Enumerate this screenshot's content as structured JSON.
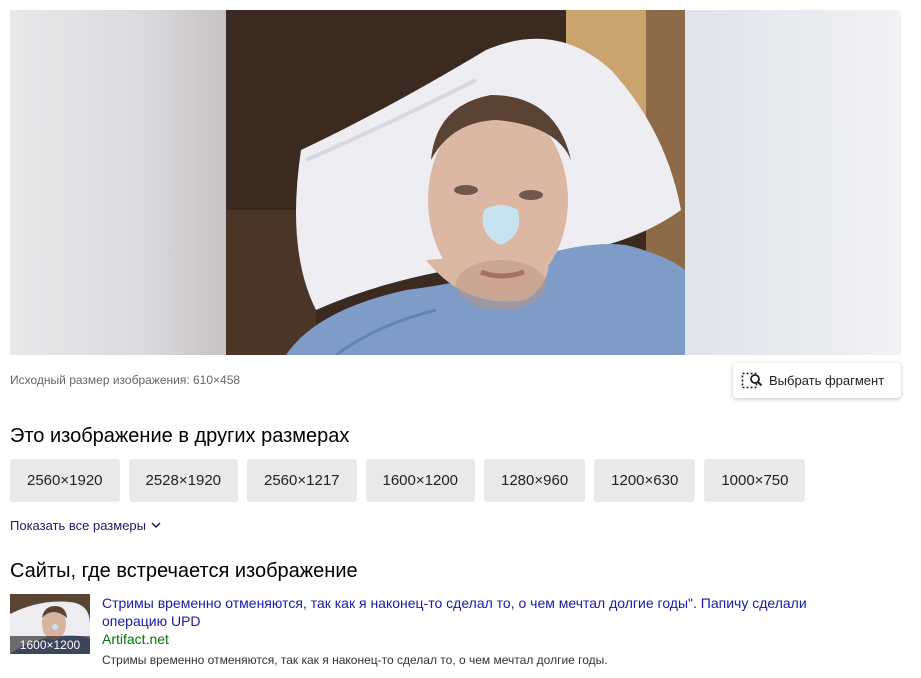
{
  "preview": {
    "image": "hospital-selfie-photo"
  },
  "original_size": {
    "caption": "Исходный размер изображения: 610×458"
  },
  "fragment_button": {
    "label": "Выбрать фрагмент",
    "icon": "select-fragment-icon"
  },
  "other_sizes": {
    "heading": "Это изображение в других размерах",
    "items": [
      {
        "label": "2560×1920"
      },
      {
        "label": "2528×1920"
      },
      {
        "label": "2560×1217"
      },
      {
        "label": "1600×1200"
      },
      {
        "label": "1280×960"
      },
      {
        "label": "1200×630"
      },
      {
        "label": "1000×750"
      }
    ],
    "show_all_label": "Показать все размеры"
  },
  "sites": {
    "heading": "Сайты, где встречается изображение",
    "items": [
      {
        "thumb_size": "1600×1200",
        "title": "Стримы временно отменяются, так как я наконец-то сделал то, о чем мечтал долгие годы\". Папичу сделали операцию UPD",
        "domain": "Artifact.net",
        "snippet": "Стримы временно отменяются, так как я наконец-то сделал то, о чем мечтал долгие годы."
      }
    ]
  },
  "colors": {
    "link": "#1a1aa6",
    "domain": "#007700",
    "chip_bg": "#e9e9e9"
  }
}
